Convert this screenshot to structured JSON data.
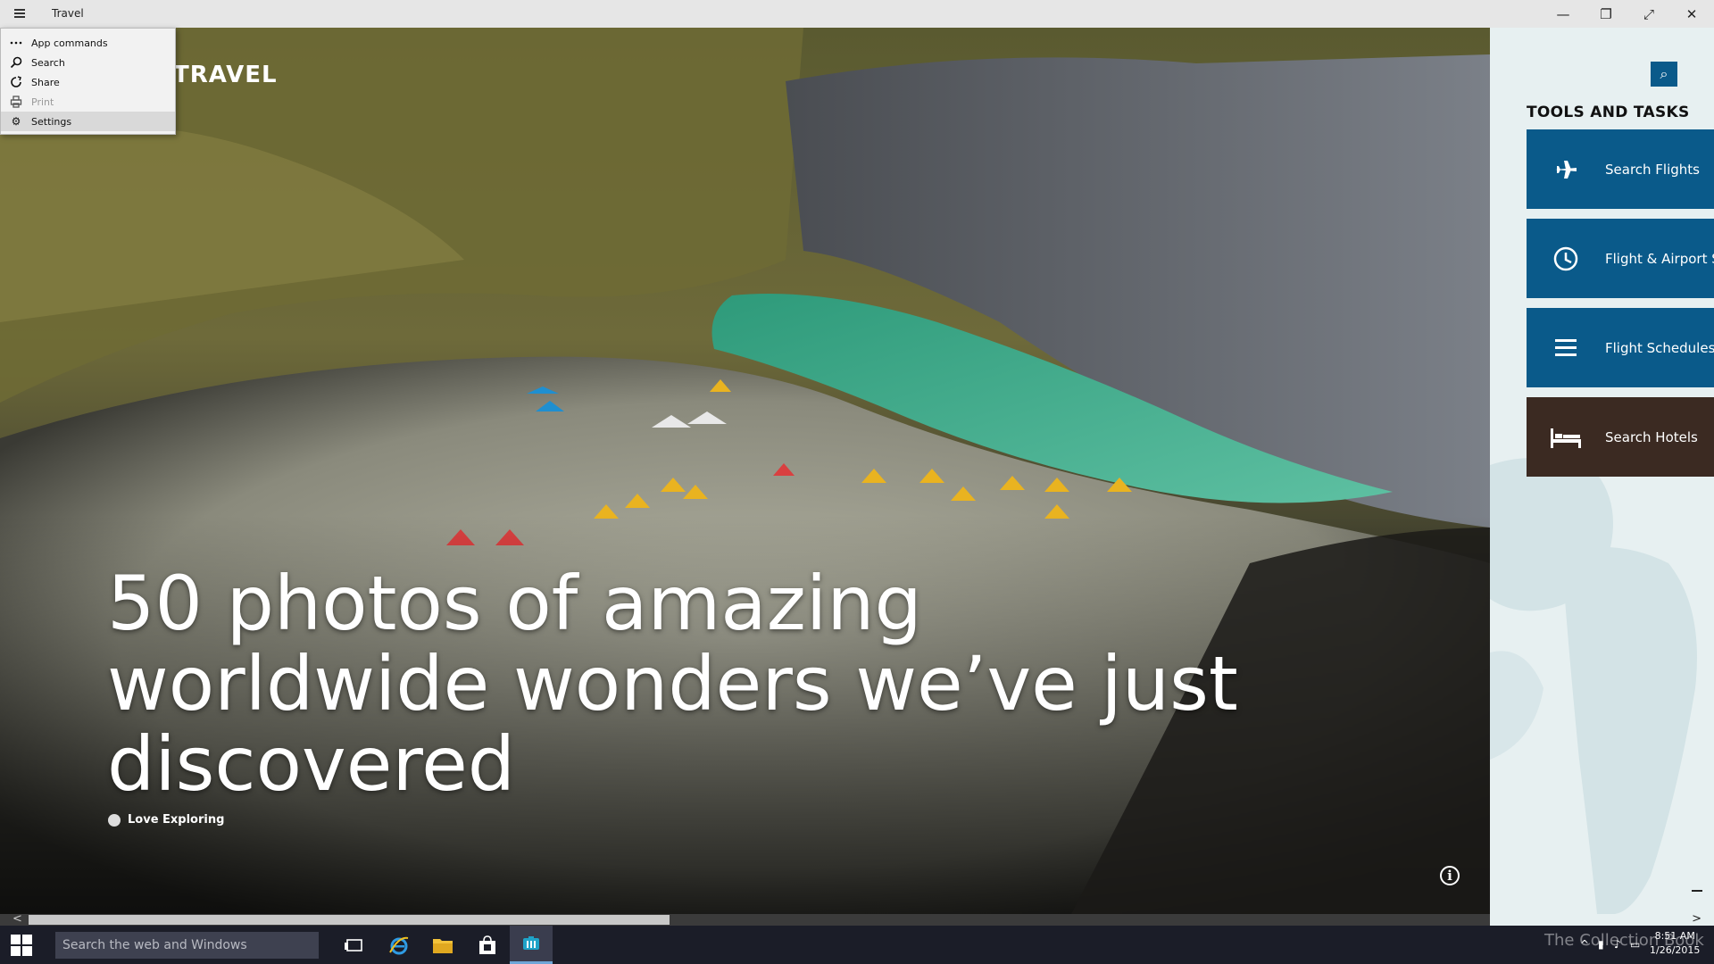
{
  "window": {
    "title": "Travel",
    "controls": {
      "minimize": "—",
      "restore": "❐",
      "fullscreen": "⤢",
      "close": "✕"
    }
  },
  "context_menu": {
    "items": [
      {
        "label": "App commands",
        "icon": "more-dots-icon",
        "disabled": false
      },
      {
        "label": "Search",
        "icon": "search-icon",
        "disabled": false
      },
      {
        "label": "Share",
        "icon": "share-icon",
        "disabled": false
      },
      {
        "label": "Print",
        "icon": "print-icon",
        "disabled": true
      },
      {
        "label": "Settings",
        "icon": "gear-icon",
        "disabled": false,
        "highlighted": true
      }
    ]
  },
  "hero": {
    "section_label": "TRAVEL",
    "headline": "50 photos of amazing worldwide wonders we’ve just discovered",
    "source": "Love Exploring",
    "info_symbol": "i"
  },
  "panel": {
    "title": "TOOLS AND TASKS",
    "search_symbol": "⌕",
    "tiles": [
      {
        "label": "Search Flights",
        "icon": "airplane-icon",
        "color": "#0a5a8a"
      },
      {
        "label": "Flight & Airport S",
        "icon": "clock-icon",
        "color": "#0a5a8a"
      },
      {
        "label": "Flight Schedules",
        "icon": "list-icon",
        "color": "#0a5a8a"
      },
      {
        "label": "Search Hotels",
        "icon": "bed-icon",
        "color": "#3b2a22"
      }
    ]
  },
  "taskbar": {
    "search_placeholder": "Search the web and Windows",
    "apps": [
      "task-view-icon",
      "internet-explorer-icon",
      "file-explorer-icon",
      "store-icon",
      "travel-app-icon"
    ],
    "watermark": "The Collection Book",
    "time": "8:51 AM",
    "date": "1/26/2015"
  },
  "colors": {
    "accent": "#0a5a8a",
    "hotel_tile": "#3b2a22",
    "taskbar": "#1b1d28",
    "panel_bg": "#e7f0f1"
  }
}
